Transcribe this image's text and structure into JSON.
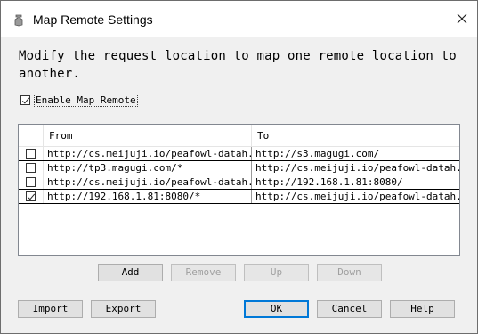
{
  "window": {
    "title": "Map Remote Settings"
  },
  "description": "Modify the request location to map one remote location to another.",
  "enable": {
    "label": "Enable Map Remote",
    "checked": true
  },
  "table": {
    "columns": {
      "from": "From",
      "to": "To"
    },
    "rows": [
      {
        "checked": false,
        "from": "http://cs.meijuji.io/peafowl-datah...",
        "to": "http://s3.magugi.com/"
      },
      {
        "checked": false,
        "from": "http://tp3.magugi.com/*",
        "to": "http://cs.meijuji.io/peafowl-datah..."
      },
      {
        "checked": false,
        "from": "http://cs.meijuji.io/peafowl-datah...",
        "to": "http://192.168.1.81:8080/"
      },
      {
        "checked": true,
        "from": "http://192.168.1.81:8080/*",
        "to": "http://cs.meijuji.io/peafowl-datah..."
      }
    ]
  },
  "list_buttons": {
    "add": "Add",
    "remove": "Remove",
    "up": "Up",
    "down": "Down"
  },
  "bottom_buttons": {
    "import": "Import",
    "export": "Export",
    "ok": "OK",
    "cancel": "Cancel",
    "help": "Help"
  }
}
